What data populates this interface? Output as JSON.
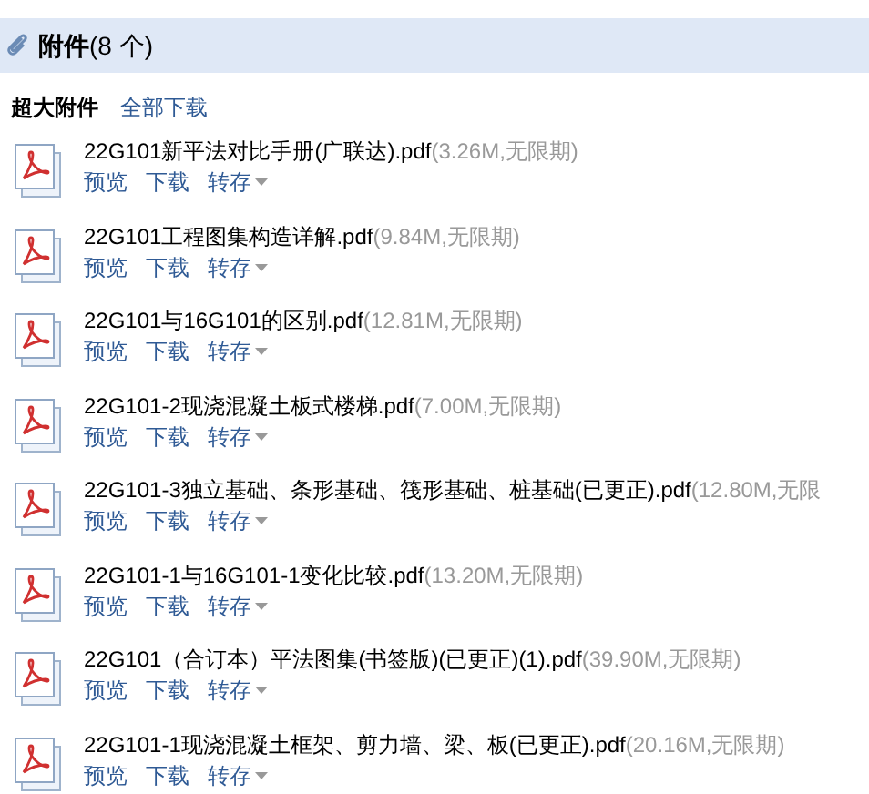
{
  "header": {
    "title": "附件",
    "count": "(8 个)"
  },
  "subheader": {
    "label": "超大附件",
    "download_all": "全部下载"
  },
  "files": [
    {
      "name": "22G101新平法对比手册(广联达).pdf",
      "meta": "(3.26M,无限期)",
      "actions": [
        "预览",
        "下载",
        "转存"
      ]
    },
    {
      "name": "22G101工程图集构造详解.pdf",
      "meta": "(9.84M,无限期)",
      "actions": [
        "预览",
        "下载",
        "转存"
      ]
    },
    {
      "name": "22G101与16G101的区别.pdf",
      "meta": "(12.81M,无限期)",
      "actions": [
        "预览",
        "下载",
        "转存"
      ]
    },
    {
      "name": "22G101-2现浇混凝土板式楼梯.pdf",
      "meta": "(7.00M,无限期)",
      "actions": [
        "预览",
        "下载",
        "转存"
      ]
    },
    {
      "name": "22G101-3独立基础、条形基础、筏形基础、桩基础(已更正).pdf",
      "meta": "(12.80M,无限",
      "actions": [
        "预览",
        "下载",
        "转存"
      ]
    },
    {
      "name": "22G101-1与16G101-1变化比较.pdf",
      "meta": "(13.20M,无限期)",
      "actions": [
        "预览",
        "下载",
        "转存"
      ]
    },
    {
      "name": "22G101（合订本）平法图集(书签版)(已更正)(1).pdf",
      "meta": "(39.90M,无限期)",
      "actions": [
        "预览",
        "下载",
        "转存"
      ]
    },
    {
      "name": "22G101-1现浇混凝土框架、剪力墙、梁、板(已更正).pdf",
      "meta": "(20.16M,无限期)",
      "actions": [
        "预览",
        "下载",
        "转存"
      ]
    }
  ]
}
